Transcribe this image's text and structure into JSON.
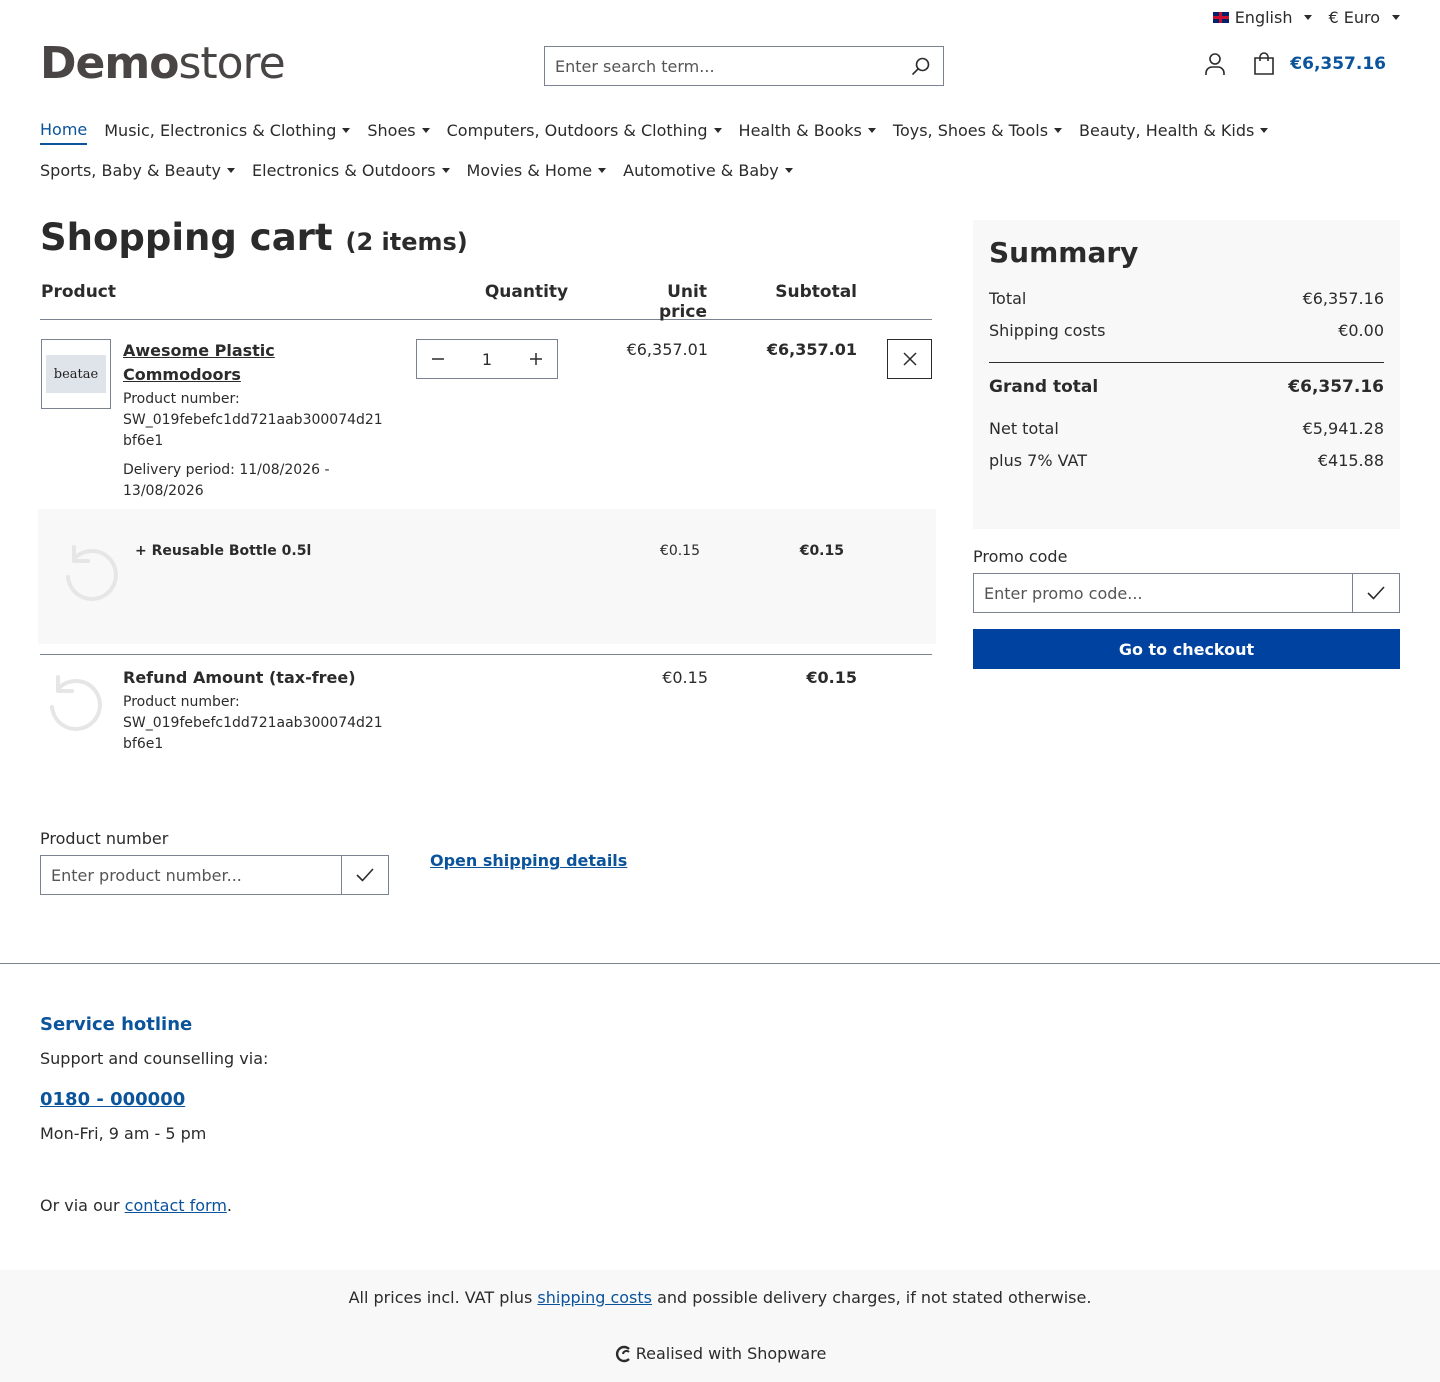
{
  "topbar": {
    "language": "English",
    "currency": "€ Euro"
  },
  "header": {
    "logo_bold": "Demo",
    "logo_light": "store",
    "search_placeholder": "Enter search term...",
    "cart_total": "€6,357.16"
  },
  "nav": {
    "row1": [
      {
        "label": "Home",
        "active": true,
        "dropdown": false
      },
      {
        "label": "Music, Electronics & Clothing",
        "dropdown": true
      },
      {
        "label": "Shoes",
        "dropdown": true
      },
      {
        "label": "Computers, Outdoors & Clothing",
        "dropdown": true
      },
      {
        "label": "Health & Books",
        "dropdown": true
      },
      {
        "label": "Toys, Shoes & Tools",
        "dropdown": true
      },
      {
        "label": "Beauty, Health & Kids",
        "dropdown": true
      }
    ],
    "row2": [
      {
        "label": "Sports, Baby & Beauty",
        "dropdown": true
      },
      {
        "label": "Electronics & Outdoors",
        "dropdown": true
      },
      {
        "label": "Movies & Home",
        "dropdown": true
      },
      {
        "label": "Automotive & Baby",
        "dropdown": true
      }
    ]
  },
  "cart": {
    "title": "Shopping cart",
    "count": "(2 items)",
    "headers": {
      "product": "Product",
      "quantity": "Quantity",
      "unit_price": "Unit price",
      "subtotal": "Subtotal"
    },
    "item1": {
      "image_text": "beatae",
      "name_line1": "Awesome Plastic",
      "name_line2": "Commodoors",
      "number_label": "Product number:",
      "number_line1": "SW_019febefc1dd721aab300074d21",
      "number_line2": "bf6e1",
      "delivery_line1": "Delivery period: 11/08/2026 -",
      "delivery_line2": "13/08/2026",
      "quantity": "1",
      "unit_price": "€6,357.01",
      "subtotal": "€6,357.01"
    },
    "nested": {
      "label": "+ Reusable Bottle 0.5l",
      "unit_price": "€0.15",
      "subtotal": "€0.15"
    },
    "item2": {
      "name": "Refund Amount (tax-free)",
      "number_label": "Product number:",
      "number_line1": "SW_019febefc1dd721aab300074d21",
      "number_line2": "bf6e1",
      "unit_price": "€0.15",
      "subtotal": "€0.15"
    },
    "product_number_label": "Product number",
    "product_number_placeholder": "Enter product number...",
    "shipping_link": "Open shipping details"
  },
  "summary": {
    "title": "Summary",
    "total_label": "Total",
    "total": "€6,357.16",
    "shipping_label": "Shipping costs",
    "shipping": "€0.00",
    "grand_label": "Grand total",
    "grand": "€6,357.16",
    "net_label": "Net total",
    "net": "€5,941.28",
    "vat_label": "plus 7% VAT",
    "vat": "€415.88",
    "promo_label": "Promo code",
    "promo_placeholder": "Enter promo code...",
    "checkout": "Go to checkout"
  },
  "footer": {
    "hotline_title": "Service hotline",
    "hotline_sub": "Support and counselling via:",
    "phone": "0180 - 000000",
    "hours": "Mon-Fri, 9 am - 5 pm",
    "contact_prefix": "Or via our ",
    "contact_link": "contact form",
    "contact_suffix": ".",
    "vat_prefix": "All prices incl. VAT plus ",
    "vat_link": "shipping costs",
    "vat_suffix": " and possible delivery charges, if not stated otherwise.",
    "realised": "Realised with Shopware"
  },
  "colors": {
    "accent": "#0b539b",
    "checkout": "#0042a0",
    "text": "#2b2b2b",
    "panel": "#f8f8f8"
  }
}
